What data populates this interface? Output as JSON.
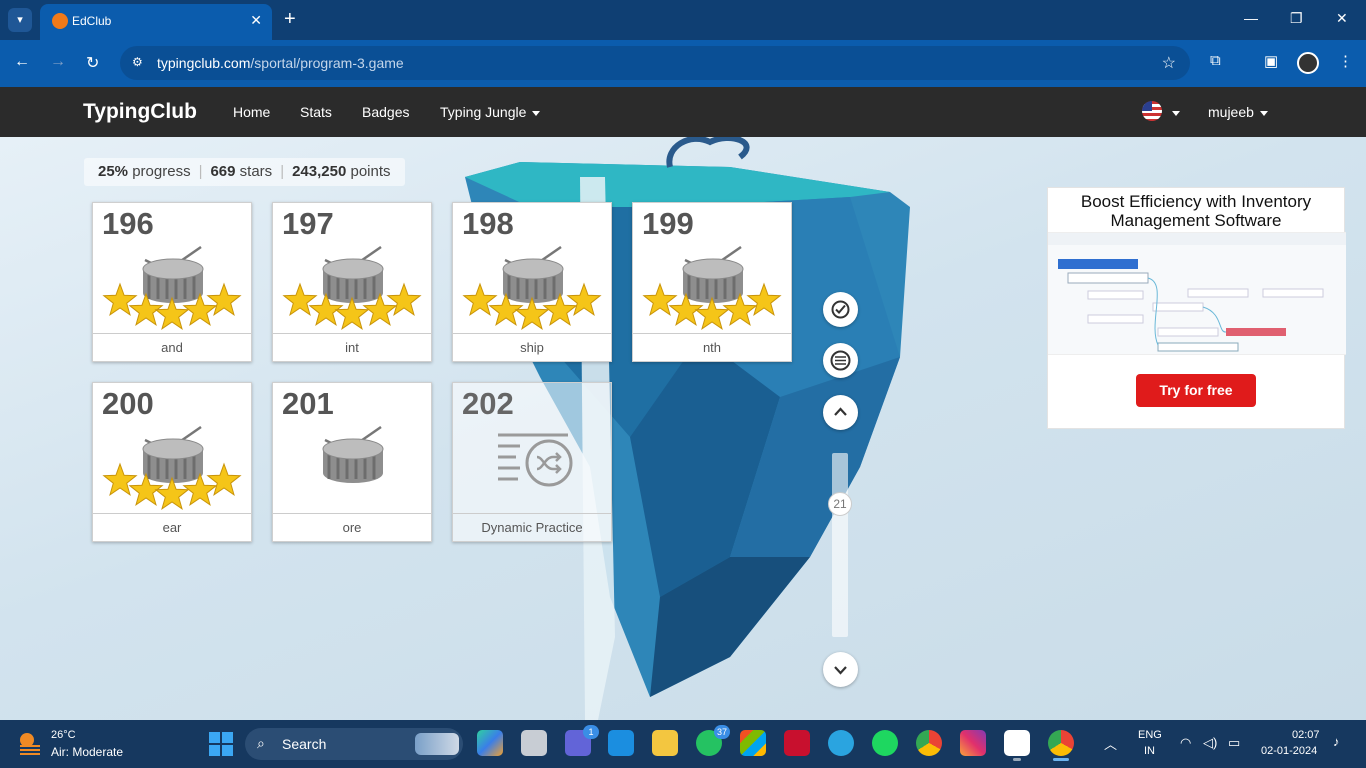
{
  "browser": {
    "tab_title": "EdClub",
    "url_host": "typingclub.com",
    "url_path": "/sportal/program-3.game",
    "tab_close": "✕",
    "new_tab": "+",
    "minimize": "—",
    "maximize": "❐",
    "close": "✕"
  },
  "site": {
    "logo": "TypingClub",
    "nav": {
      "home": "Home",
      "stats": "Stats",
      "badges": "Badges",
      "typing_jungle": "Typing Jungle"
    },
    "user": "mujeeb"
  },
  "stats": {
    "progress_value": "25%",
    "progress_label": "progress",
    "stars_value": "669",
    "stars_label": "stars",
    "points_value": "243,250",
    "points_label": "points"
  },
  "lessons": [
    {
      "number": "196",
      "label": "and",
      "stars": 5,
      "icon": "drum-icon"
    },
    {
      "number": "197",
      "label": "int",
      "stars": 5,
      "icon": "drum-icon"
    },
    {
      "number": "198",
      "label": "ship",
      "stars": 5,
      "icon": "drum-icon"
    },
    {
      "number": "199",
      "label": "nth",
      "stars": 5,
      "icon": "drum-icon"
    },
    {
      "number": "200",
      "label": "ear",
      "stars": 5,
      "icon": "drum-icon"
    },
    {
      "number": "201",
      "label": "ore",
      "stars": 0,
      "icon": "drum-icon"
    },
    {
      "number": "202",
      "label": "Dynamic Practice",
      "stars": 0,
      "icon": "shuffle-icon",
      "locked": true
    }
  ],
  "controls": {
    "scroll_position": "21"
  },
  "ad": {
    "title": "Boost Efficiency with Inventory Management Software",
    "button": "Try for free"
  },
  "taskbar": {
    "temperature": "26°C",
    "air_quality": "Air: Moderate",
    "search": "Search",
    "teams_badge": "1",
    "whatsapp_badge": "37",
    "lang_1": "ENG",
    "lang_2": "IN",
    "time": "02:07",
    "date": "02-01-2024"
  },
  "colors": {
    "browser_frame": "#0f3f73",
    "site_nav": "#2b2b2b",
    "star": "#f5c518",
    "ad_button": "#e01b1b",
    "taskbar": "#16385f"
  }
}
